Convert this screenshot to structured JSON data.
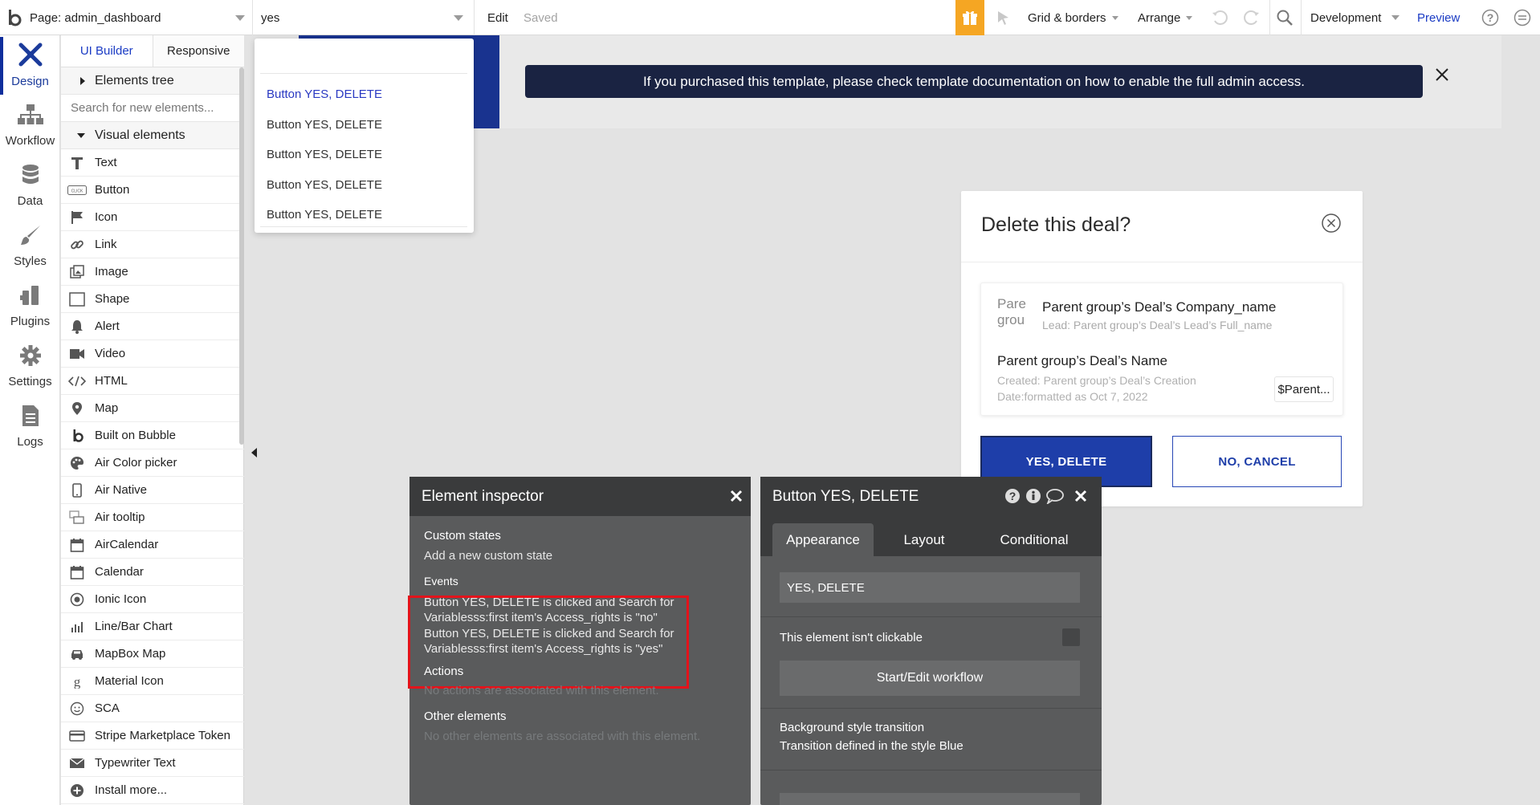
{
  "topbar": {
    "logo": "b",
    "page_label": "Page: admin_dashboard",
    "element_search_value": "yes",
    "edit_label": "Edit",
    "saved_label": "Saved",
    "grid_label": "Grid & borders",
    "arrange_label": "Arrange",
    "development_label": "Development",
    "preview_label": "Preview",
    "gift_color": "#f5a623",
    "accent_color": "#1a3bc4"
  },
  "leftnav": {
    "items": [
      {
        "label": "Design",
        "icon": "design-icon"
      },
      {
        "label": "Workflow",
        "icon": "workflow-icon"
      },
      {
        "label": "Data",
        "icon": "database-icon"
      },
      {
        "label": "Styles",
        "icon": "brush-icon"
      },
      {
        "label": "Plugins",
        "icon": "plugin-icon"
      },
      {
        "label": "Settings",
        "icon": "gear-icon"
      },
      {
        "label": "Logs",
        "icon": "document-icon"
      }
    ]
  },
  "panel": {
    "tabs": [
      "UI Builder",
      "Responsive"
    ],
    "elements_tree": "Elements tree",
    "search_placeholder": "Search for new elements...",
    "visual_elements": "Visual elements",
    "elements": [
      {
        "label": "Text",
        "icon": "text-icon"
      },
      {
        "label": "Button",
        "icon": "button-icon"
      },
      {
        "label": "Icon",
        "icon": "flag-icon"
      },
      {
        "label": "Link",
        "icon": "link-icon"
      },
      {
        "label": "Image",
        "icon": "image-icon"
      },
      {
        "label": "Shape",
        "icon": "shape-icon"
      },
      {
        "label": "Alert",
        "icon": "bell-icon"
      },
      {
        "label": "Video",
        "icon": "video-icon"
      },
      {
        "label": "HTML",
        "icon": "code-icon"
      },
      {
        "label": "Map",
        "icon": "map-pin-icon"
      },
      {
        "label": "Built on Bubble",
        "icon": "bubble-logo-icon"
      },
      {
        "label": "Air Color picker",
        "icon": "palette-icon"
      },
      {
        "label": "Air Native",
        "icon": "phone-icon"
      },
      {
        "label": "Air tooltip",
        "icon": "tooltip-icon"
      },
      {
        "label": "AirCalendar",
        "icon": "calendar-icon"
      },
      {
        "label": "Calendar",
        "icon": "calendar-icon"
      },
      {
        "label": "Ionic Icon",
        "icon": "ionic-icon"
      },
      {
        "label": "Line/Bar Chart",
        "icon": "chart-icon"
      },
      {
        "label": "MapBox Map",
        "icon": "car-icon"
      },
      {
        "label": "Material Icon",
        "icon": "material-icon"
      },
      {
        "label": "SCA",
        "icon": "smiley-icon"
      },
      {
        "label": "Stripe Marketplace Token",
        "icon": "card-icon"
      },
      {
        "label": "Typewriter Text",
        "icon": "mail-icon"
      },
      {
        "label": "Install more...",
        "icon": "plus-circle-icon"
      }
    ]
  },
  "dropdown": {
    "items": [
      "Button YES, DELETE",
      "Button YES, DELETE",
      "Button YES, DELETE",
      "Button YES, DELETE",
      "Button YES, DELETE"
    ]
  },
  "notice": {
    "text": "If you purchased this template, please check template documentation on how to enable the full admin access."
  },
  "modal": {
    "title": "Delete this deal?",
    "avatar_text": "Pare grou",
    "company": "Parent group’s Deal’s Company_name",
    "lead": "Lead: Parent group’s Deal’s Lead’s Full_name",
    "deal_name": "Parent group’s Deal’s Name",
    "created": "Created: Parent group’s Deal’s Creation Date:formatted as Oct 7, 2022",
    "price": "$Parent...",
    "yes_label": "YES, DELETE",
    "no_label": "NO, CANCEL",
    "primary_color": "#1e3ea9"
  },
  "inspector": {
    "title": "Element inspector",
    "custom_states_label": "Custom states",
    "add_state": "Add a new custom state",
    "events_label": "Events",
    "events": [
      "Button YES, DELETE is clicked and Search for Variablesss:first item's Access_rights is \"no\"",
      "Button YES, DELETE is clicked and Search for Variablesss:first item's Access_rights is \"yes\""
    ],
    "actions_label": "Actions",
    "actions_empty": "No actions are associated with this element.",
    "other_label": "Other elements",
    "other_empty": "No other elements are associated with this element.",
    "highlight_color": "#e3131b"
  },
  "editor": {
    "title": "Button YES, DELETE",
    "tabs": [
      "Appearance",
      "Layout",
      "Conditional"
    ],
    "text_value": "YES, DELETE",
    "not_clickable_label": "This element isn't clickable",
    "workflow_button": "Start/Edit workflow",
    "bg_transition_label": "Background style transition",
    "transition_text": "Transition defined in the style Blue"
  }
}
